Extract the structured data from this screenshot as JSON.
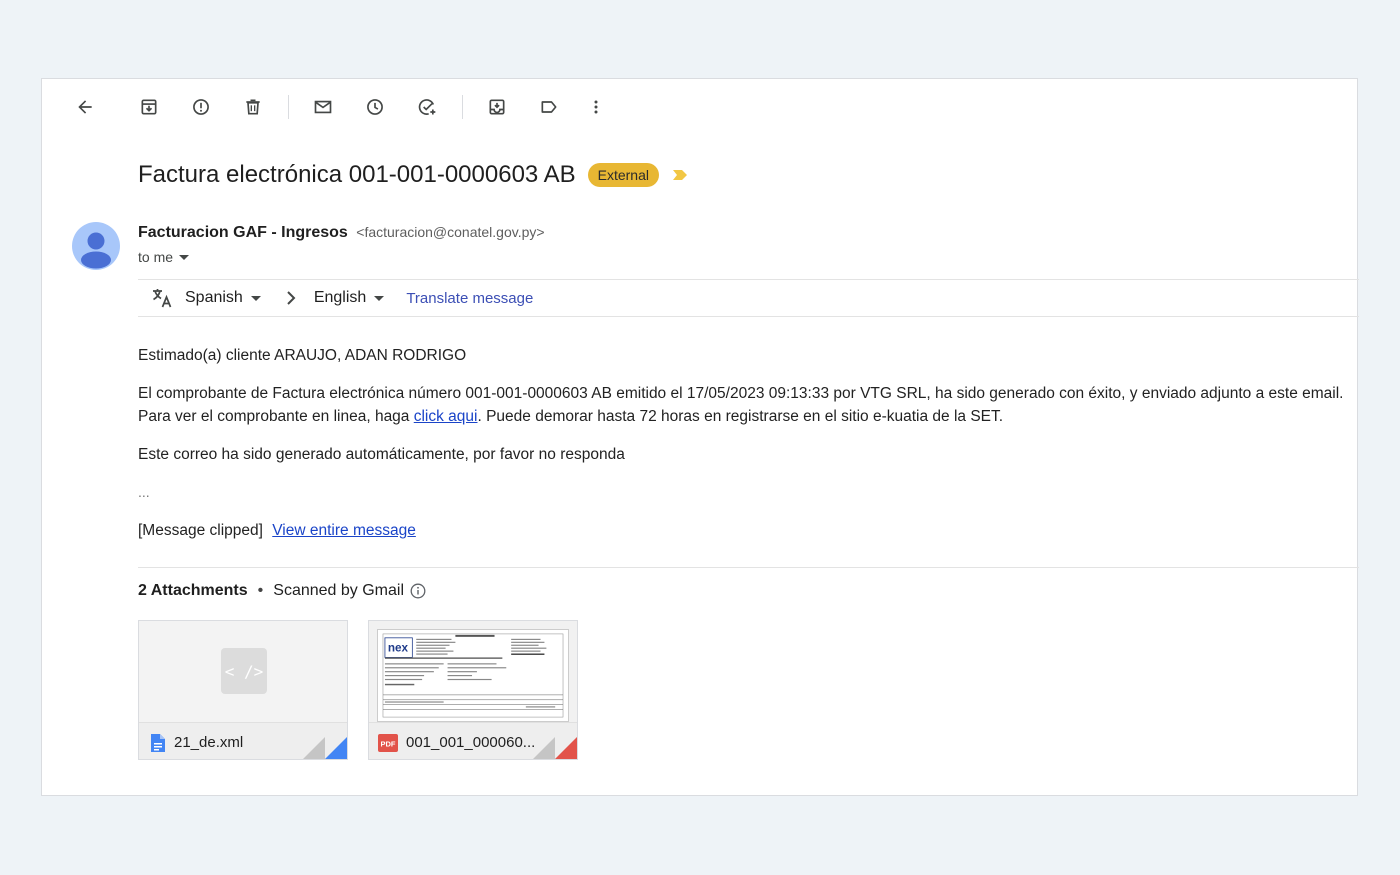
{
  "toolbar": {
    "back": "back-arrow-icon",
    "archive": "archive-icon",
    "spam": "report-spam-icon",
    "delete": "trash-icon",
    "mark_unread": "mail-icon",
    "snooze": "clock-icon",
    "add_task": "add-task-icon",
    "move_to": "move-to-icon",
    "labels": "label-icon",
    "more": "more-vert-icon"
  },
  "email": {
    "subject": "Factura electrónica 001-001-0000603 AB",
    "external_badge": "External",
    "sender_name": "Facturacion GAF - Ingresos",
    "sender_email": "<facturacion@conatel.gov.py>",
    "to_label": "to me"
  },
  "translate": {
    "source_lang": "Spanish",
    "target_lang": "English",
    "action": "Translate message"
  },
  "body": {
    "greeting": "Estimado(a) cliente ARAUJO, ADAN RODRIGO",
    "p1": "El comprobante de Factura electrónica número 001-001-0000603 AB emitido el 17/05/2023 09:13:33 por VTG SRL, ha sido generado con éxito, y enviado adjunto a este email.",
    "p2_before": "Para ver el comprobante en linea, haga ",
    "p2_link": "click aqui",
    "p2_after": ". Puede demorar hasta 72 horas en registrarse en el sitio e-kuatia de la SET.",
    "p3": "Este correo ha sido generado automáticamente, por favor no responda",
    "ellipsis": "...",
    "clipped": "[Message clipped]",
    "view_entire": "View entire message"
  },
  "attachments": {
    "count_label": "2 Attachments",
    "dot": "•",
    "scanned": "Scanned by Gmail",
    "items": [
      {
        "name": "21_de.xml",
        "icon": "doc-file-icon",
        "preview": "< />"
      },
      {
        "name": "001_001_000060...",
        "icon": "pdf-file-icon",
        "badge": "PDF"
      }
    ]
  },
  "colors": {
    "external_badge": "#e8b733",
    "link": "#1a44c8",
    "translate_link": "#3c4fb5",
    "avatar": "#a8c7fa",
    "avatar_figure": "#4a6fd4"
  }
}
